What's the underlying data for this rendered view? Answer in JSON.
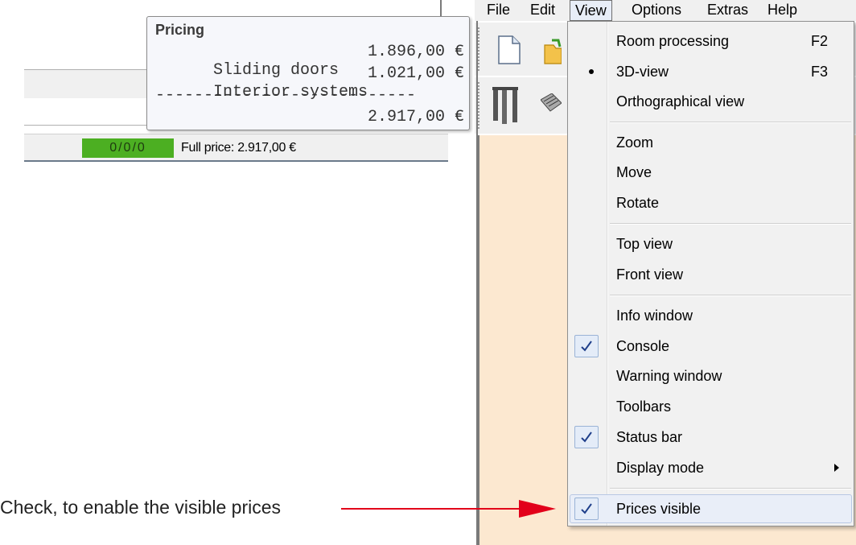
{
  "pricing_tooltip": {
    "title": "Pricing",
    "rows": [
      {
        "label": "Sliding doors",
        "amount": "1.896,00 €"
      },
      {
        "label": "Interior systems",
        "amount": "1.021,00 €"
      }
    ],
    "separator": "---------------------------",
    "total": "2.917,00 €"
  },
  "status_bar": {
    "counter": "0/0/0",
    "full_price": "Full price: 2.917,00 €"
  },
  "menubar": {
    "items": [
      "File",
      "Edit",
      "View",
      "Options",
      "Extras",
      "Help"
    ],
    "active": "View"
  },
  "view_menu": {
    "items": [
      {
        "label": "Room processing",
        "shortcut": "F2",
        "state": "none"
      },
      {
        "label": "3D-view",
        "shortcut": "F3",
        "state": "radio"
      },
      {
        "label": "Orthographical view",
        "shortcut": "",
        "state": "none"
      },
      {
        "label": "Zoom",
        "shortcut": "",
        "state": "none"
      },
      {
        "label": "Move",
        "shortcut": "",
        "state": "none"
      },
      {
        "label": "Rotate",
        "shortcut": "",
        "state": "none"
      },
      {
        "label": "Top view",
        "shortcut": "",
        "state": "none"
      },
      {
        "label": "Front view",
        "shortcut": "",
        "state": "none"
      },
      {
        "label": "Info window",
        "shortcut": "",
        "state": "none"
      },
      {
        "label": "Console",
        "shortcut": "",
        "state": "checked"
      },
      {
        "label": "Warning window",
        "shortcut": "",
        "state": "none"
      },
      {
        "label": "Toolbars",
        "shortcut": "",
        "state": "none"
      },
      {
        "label": "Status bar",
        "shortcut": "",
        "state": "checked"
      },
      {
        "label": "Display mode",
        "shortcut": "",
        "state": "submenu"
      },
      {
        "label": "Prices visible",
        "shortcut": "",
        "state": "checked-highlighted"
      }
    ]
  },
  "annotation": {
    "text": "Check, to enable the visible prices",
    "arrow_color": "#e2001a"
  },
  "colors": {
    "status_counter_bg": "#4caf22",
    "workspace_bg": "#fce8d0",
    "menu_highlight": "#e9eef8"
  },
  "icons": [
    "new-document-icon",
    "open-folder-icon",
    "door-tool-icon",
    "shelf-tool-icon",
    "checkmark-icon",
    "submenu-arrow-icon"
  ]
}
